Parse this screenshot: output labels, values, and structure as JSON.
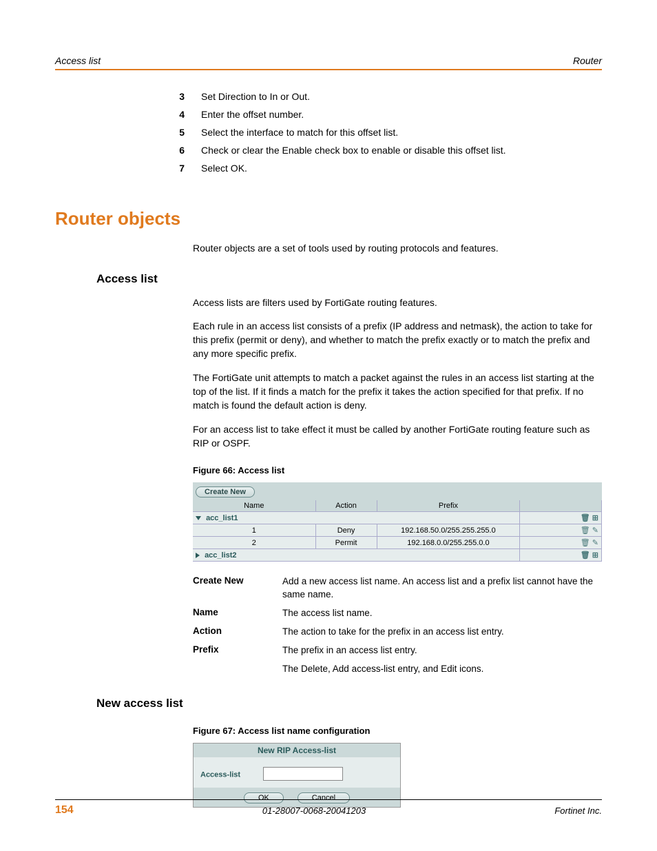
{
  "header": {
    "left": "Access list",
    "right": "Router"
  },
  "steps": [
    {
      "num": "3",
      "text": "Set Direction to In or Out."
    },
    {
      "num": "4",
      "text": "Enter the offset number."
    },
    {
      "num": "5",
      "text": "Select the interface to match for this offset list."
    },
    {
      "num": "6",
      "text": "Check or clear the Enable check box to enable or disable this offset list."
    },
    {
      "num": "7",
      "text": "Select OK."
    }
  ],
  "section_title": "Router objects",
  "intro": "Router objects are a set of tools used by routing protocols and features.",
  "access_list": {
    "heading": "Access list",
    "p1": "Access lists are filters used by FortiGate routing features.",
    "p2": "Each rule in an access list consists of a prefix (IP address and netmask), the action to take for this prefix (permit or deny), and whether to match the prefix exactly or to match the prefix and any more specific prefix.",
    "p3": "The FortiGate unit attempts to match a packet against the rules in an access list starting at the top of the list. If it finds a match for the prefix it takes the action specified for that prefix. If no match is found the default action is deny.",
    "p4": "For an access list to take effect it must be called by another FortiGate routing feature such as RIP or OSPF."
  },
  "figure66": {
    "caption": "Figure 66: Access list",
    "create_new": "Create New",
    "columns": {
      "name": "Name",
      "action": "Action",
      "prefix": "Prefix"
    },
    "group1": {
      "name": "acc_list1"
    },
    "rows": [
      {
        "name": "1",
        "action": "Deny",
        "prefix": "192.168.50.0/255.255.255.0"
      },
      {
        "name": "2",
        "action": "Permit",
        "prefix": "192.168.0.0/255.255.0.0"
      }
    ],
    "group2": {
      "name": "acc_list2"
    }
  },
  "definitions": [
    {
      "term": "Create New",
      "desc": "Add a new access list name. An access list and a prefix list cannot have the same name."
    },
    {
      "term": "Name",
      "desc": "The access list name."
    },
    {
      "term": "Action",
      "desc": "The action to take for the prefix in an access list entry."
    },
    {
      "term": "Prefix",
      "desc": "The prefix in an access list entry."
    },
    {
      "term": "",
      "desc": "The Delete, Add access-list entry, and Edit icons."
    }
  ],
  "new_access_list": {
    "heading": "New access list",
    "caption": "Figure 67: Access list name configuration",
    "title": "New RIP Access-list",
    "label": "Access-list",
    "ok": "OK",
    "cancel": "Cancel"
  },
  "footer": {
    "page": "154",
    "doc_id": "01-28007-0068-20041203",
    "company": "Fortinet Inc."
  }
}
